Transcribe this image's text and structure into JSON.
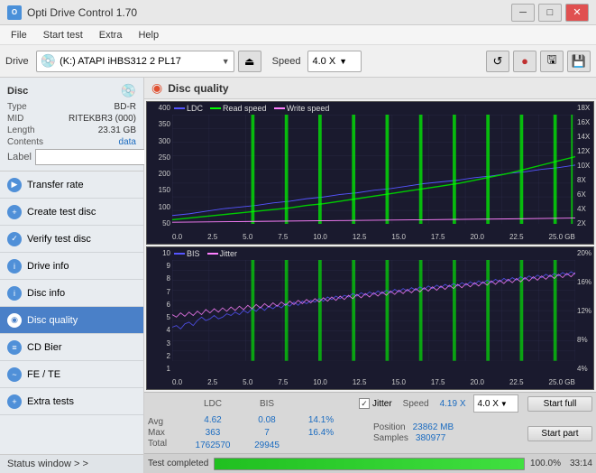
{
  "titleBar": {
    "icon": "O",
    "title": "Opti Drive Control 1.70",
    "minBtn": "─",
    "maxBtn": "□",
    "closeBtn": "✕"
  },
  "menuBar": {
    "items": [
      "File",
      "Start test",
      "Extra",
      "Help"
    ]
  },
  "toolbar": {
    "driveLabel": "Drive",
    "driveIcon": "💿",
    "driveValue": "(K:)  ATAPI iHBS312  2 PL17",
    "ejectIcon": "⏏",
    "speedLabel": "Speed",
    "speedValue": "4.0 X",
    "icons": [
      "↺",
      "🔴",
      "💾",
      "💾"
    ]
  },
  "sidebar": {
    "disc": {
      "label": "Disc",
      "type_label": "Type",
      "type_value": "BD-R",
      "mid_label": "MID",
      "mid_value": "RITEKBR3 (000)",
      "length_label": "Length",
      "length_value": "23.31 GB",
      "contents_label": "Contents",
      "contents_value": "data",
      "label_label": "Label",
      "label_value": ""
    },
    "navItems": [
      {
        "id": "transfer-rate",
        "label": "Transfer rate",
        "active": false
      },
      {
        "id": "create-test-disc",
        "label": "Create test disc",
        "active": false
      },
      {
        "id": "verify-test-disc",
        "label": "Verify test disc",
        "active": false
      },
      {
        "id": "drive-info",
        "label": "Drive info",
        "active": false
      },
      {
        "id": "disc-info",
        "label": "Disc info",
        "active": false
      },
      {
        "id": "disc-quality",
        "label": "Disc quality",
        "active": true
      },
      {
        "id": "cd-bier",
        "label": "CD Bier",
        "active": false
      },
      {
        "id": "fe-te",
        "label": "FE / TE",
        "active": false
      },
      {
        "id": "extra-tests",
        "label": "Extra tests",
        "active": false
      }
    ],
    "statusWindow": "Status window > >"
  },
  "contentHeader": {
    "icon": "◉",
    "title": "Disc quality"
  },
  "chart1": {
    "legend": [
      {
        "label": "LDC",
        "color": "#4444ff"
      },
      {
        "label": "Read speed",
        "color": "#00ff00"
      },
      {
        "label": "Write speed",
        "color": "#ff00ff"
      }
    ],
    "yLabels": [
      "400",
      "350",
      "300",
      "250",
      "200",
      "150",
      "100",
      "50"
    ],
    "yLabelsRight": [
      "18X",
      "16X",
      "14X",
      "12X",
      "10X",
      "8X",
      "6X",
      "4X",
      "2X"
    ],
    "xLabels": [
      "0.0",
      "2.5",
      "5.0",
      "7.5",
      "10.0",
      "12.5",
      "15.0",
      "17.5",
      "20.0",
      "22.5",
      "25.0 GB"
    ]
  },
  "chart2": {
    "legend": [
      {
        "label": "BIS",
        "color": "#4444ff"
      },
      {
        "label": "Jitter",
        "color": "#ff80ff"
      }
    ],
    "yLabels": [
      "10",
      "9",
      "8",
      "7",
      "6",
      "5",
      "4",
      "3",
      "2",
      "1"
    ],
    "yLabelsRight": [
      "20%",
      "16%",
      "12%",
      "8%",
      "4%"
    ],
    "xLabels": [
      "0.0",
      "2.5",
      "5.0",
      "7.5",
      "10.0",
      "12.5",
      "15.0",
      "17.5",
      "20.0",
      "22.5",
      "25.0 GB"
    ]
  },
  "bottomPanel": {
    "headers": [
      "LDC",
      "BIS",
      "Jitter"
    ],
    "avg": {
      "label": "Avg",
      "ldc": "4.62",
      "bis": "0.08",
      "jitter": "14.1%"
    },
    "max": {
      "label": "Max",
      "ldc": "363",
      "bis": "7",
      "jitter": "16.4%"
    },
    "total": {
      "label": "Total",
      "ldc": "1762570",
      "bis": "29945",
      "jitter": ""
    },
    "jitterLabel": "Jitter",
    "speed": {
      "label": "Speed",
      "value": "4.19 X"
    },
    "speedDropdown": "4.0 X",
    "position": {
      "label": "Position",
      "value": "23862 MB"
    },
    "samples": {
      "label": "Samples",
      "value": "380977"
    },
    "startFull": "Start full",
    "startPart": "Start part"
  },
  "progressBar": {
    "statusText": "Test completed",
    "percent": 100,
    "percentText": "100.0%",
    "time": "33:14"
  }
}
